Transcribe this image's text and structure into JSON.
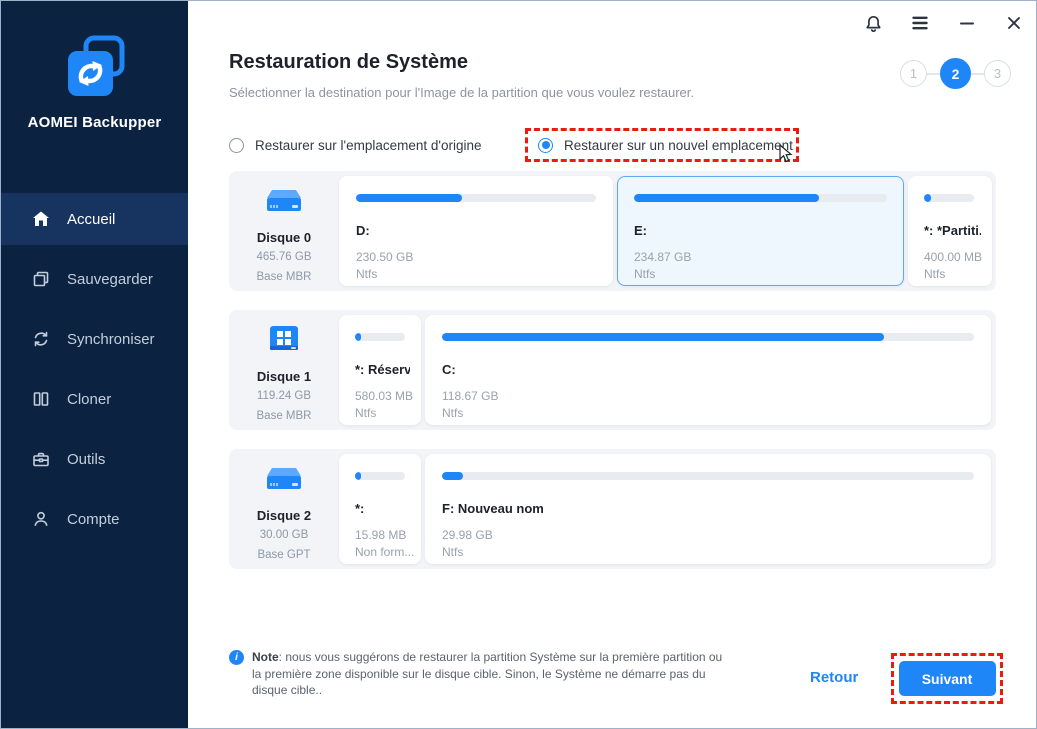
{
  "colors": {
    "accent": "#1e86f7",
    "sidebar_bg": "#0b2240",
    "sidebar_active_bg": "#17335f",
    "annotation_red": "#ea1c0d",
    "selected_card_bg": "#eef6fe"
  },
  "sidebar": {
    "brand": "AOMEI Backupper",
    "items": [
      {
        "label": "Accueil",
        "icon": "home-icon",
        "active": true
      },
      {
        "label": "Sauvegarder",
        "icon": "backup-icon",
        "active": false
      },
      {
        "label": "Synchroniser",
        "icon": "sync-icon",
        "active": false
      },
      {
        "label": "Cloner",
        "icon": "clone-icon",
        "active": false
      },
      {
        "label": "Outils",
        "icon": "toolbox-icon",
        "active": false
      },
      {
        "label": "Compte",
        "icon": "account-icon",
        "active": false
      }
    ]
  },
  "titlebar": {
    "icons": [
      "notification-bell",
      "menu",
      "minimize",
      "close"
    ]
  },
  "header": {
    "title": "Restauration de Système",
    "subtitle": "Sélectionner la destination pour l'Image de la partition que vous voulez restaurer.",
    "steps": {
      "labels": [
        "1",
        "2",
        "3"
      ],
      "active": "2"
    }
  },
  "options": [
    {
      "label": "Restaurer sur l'emplacement d'origine",
      "selected": false
    },
    {
      "label": "Restaurer sur un nouvel emplacement",
      "selected": true,
      "annotated": true
    }
  ],
  "disks": [
    {
      "name": "Disque 0",
      "size": "465.76 GB",
      "type": "Base MBR",
      "partitions": [
        {
          "label": "D:",
          "size": "230.50 GB",
          "fs": "Ntfs",
          "fill": 44,
          "selected": false
        },
        {
          "label": "E:",
          "size": "234.87 GB",
          "fs": "Ntfs",
          "fill": 73,
          "selected": true
        },
        {
          "label": "*: *Partiti...",
          "size": "400.00 MB",
          "fs": "Ntfs",
          "fill": 14,
          "selected": false
        }
      ]
    },
    {
      "name": "Disque 1",
      "size": "119.24 GB",
      "type": "Base MBR",
      "partitions": [
        {
          "label": "*: Réservé...",
          "size": "580.03 MB",
          "fs": "Ntfs",
          "fill": 12,
          "selected": false
        },
        {
          "label": "C:",
          "size": "118.67 GB",
          "fs": "Ntfs",
          "fill": 83,
          "selected": false
        }
      ]
    },
    {
      "name": "Disque 2",
      "size": "30.00 GB",
      "type": "Base GPT",
      "partitions": [
        {
          "label": "*:",
          "size": "15.98 MB",
          "fs": "Non form...",
          "fill": 12,
          "selected": false
        },
        {
          "label": "F: Nouveau nom",
          "size": "29.98 GB",
          "fs": "Ntfs",
          "fill": 4,
          "selected": false
        }
      ]
    }
  ],
  "note": {
    "bold": "Note",
    "text": ": nous vous suggérons de restaurer la partition Système sur la première partition ou la première zone disponible sur le disque cible. Sinon, le Système ne démarre pas du disque cible.."
  },
  "footer": {
    "back": "Retour",
    "next": "Suivant"
  }
}
